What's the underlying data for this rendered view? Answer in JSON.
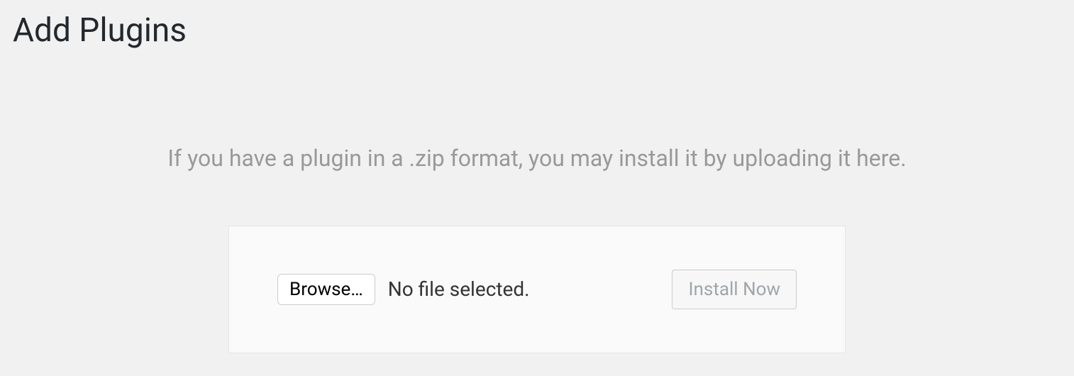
{
  "page": {
    "title": "Add Plugins"
  },
  "instruction": {
    "text": "If you have a plugin in a .zip format, you may install it by uploading it here."
  },
  "upload": {
    "browse_label": "Browse…",
    "file_status": "No file selected.",
    "install_label": "Install Now"
  }
}
